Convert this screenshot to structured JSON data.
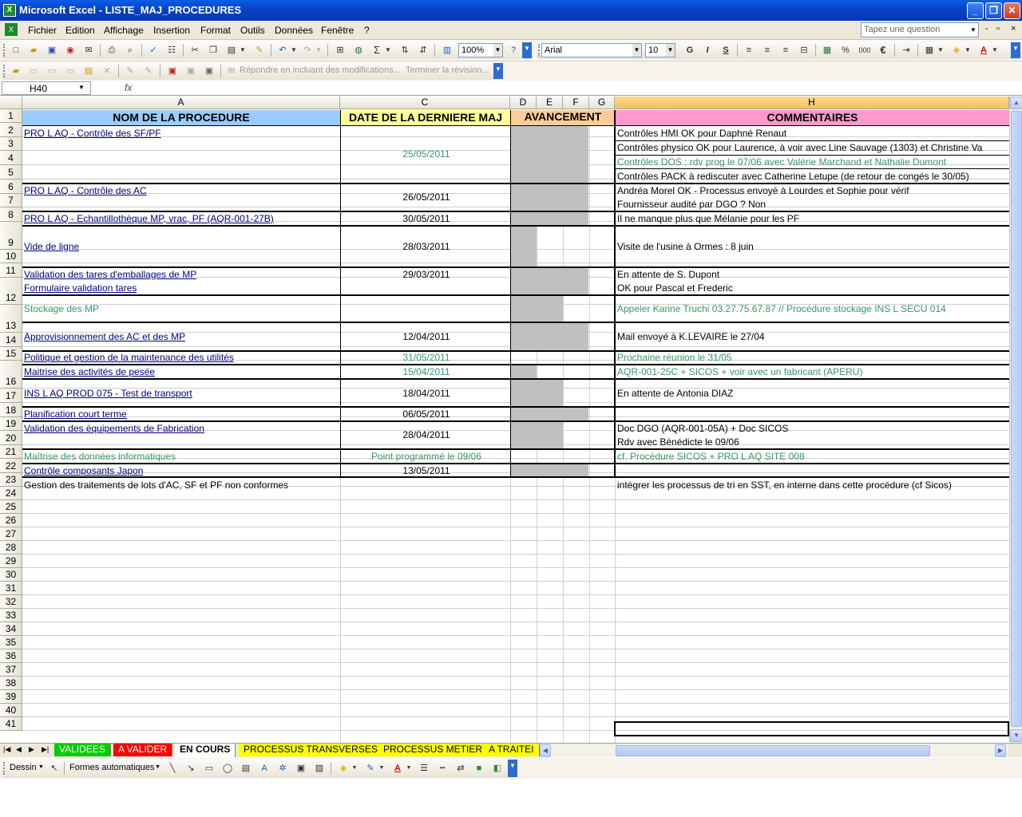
{
  "window": {
    "title": "Microsoft Excel - LISTE_MAJ_PROCEDURES",
    "minimize": "_",
    "maximize": "❐",
    "close": "✕"
  },
  "menu": {
    "items": [
      "Fichier",
      "Edition",
      "Affichage",
      "Insertion",
      "Format",
      "Outils",
      "Données",
      "Fenêtre",
      "?"
    ],
    "ask_placeholder": "Tapez une question",
    "doc_controls": [
      "-",
      "▫",
      "×"
    ]
  },
  "toolbar": {
    "zoom": "100%",
    "font": "Arial",
    "font_size": "10",
    "bold": "G",
    "italic": "I",
    "underline": "S",
    "percent": "%",
    "thousands": "000",
    "euro": "€",
    "sum": "Σ",
    "review_reply": "Répondre en incluant des modifications...",
    "review_end": "Terminer la révision..."
  },
  "formula_bar": {
    "name_box": "H40",
    "fx": "fx",
    "value": ""
  },
  "columns": [
    "A",
    "C",
    "D",
    "E",
    "F",
    "G",
    "H"
  ],
  "header_row": {
    "nom": "NOM DE LA PROCEDURE",
    "date": "DATE DE LA DERNIERE MAJ",
    "avancement": "AVANCEMENT",
    "commentaires": "COMMENTAIRES"
  },
  "colors": {
    "header_nom": "#99ccff",
    "header_date": "#ffff99",
    "header_avancement": "#ffcc99",
    "header_commentaires": "#ff99cc",
    "progress_fill": "#c0c0c0",
    "green_text": "#339966",
    "link_text": "#000080",
    "tab_validees": "#00cc00",
    "tab_a_valider": "#ff0000",
    "tab_other": "#ffff00"
  },
  "rows": {
    "r2": {
      "nom": "PRO L AQ - Contrôle des SF/PF",
      "comment": "Contrôles HMI OK pour Daphné Renaut"
    },
    "r3": {
      "comment": "Contrôles physico OK pour Laurence, à voir avec Line Sauvage (1303) et Christine Va"
    },
    "r4": {
      "comment": "Contrôles DOS : rdv prog le 07/06 avec Valérie Marchand et Nathalie Dumont"
    },
    "r5": {
      "comment": "Contrôles PACK à rediscuter avec Catherine Letupe (de retour de congés le 30/05)"
    },
    "d2_5": "25/05/2011",
    "r6": {
      "nom": "PRO L AQ - Contrôle des AC",
      "comment": "Andréa Morel OK - Processus envoyé à Lourdes et Sophie pour vérif"
    },
    "r7": {
      "comment": "Fournisseur audité par DGO ? Non"
    },
    "d6_7": "26/05/2011",
    "r8": {
      "nom": "PRO L AQ - Echantillothèque MP, vrac, PF (AQR-001-27B)",
      "date": "30/05/2011",
      "comment": "Il ne manque plus que Mélanie pour les PF"
    },
    "r9": {
      "nom": "Vide de ligne",
      "date": "28/03/2011",
      "comment": "Visite de l'usine à Ormes : 8 juin"
    },
    "r10": {
      "nom": "Validation des tares d'emballages de MP",
      "date": "29/03/2011",
      "comment": "En attente de S. Dupont"
    },
    "r11": {
      "nom": "Formulaire validation tares",
      "comment": "OK pour Pascal et Frederic"
    },
    "r12": {
      "nom": "Stockage des MP",
      "comment": "Appeler Karine Truchi 03.27.75.67.87 // Procédure stockage INS L SECU 014"
    },
    "r13": {
      "nom": "Approvisionnement des AC et des MP",
      "date": "12/04/2011",
      "comment": "Mail envoyé à K.LEVAIRE le 27/04"
    },
    "r14": {
      "nom": "Politique et gestion de la maintenance des utilités",
      "date": "31/05/2011",
      "comment": "Prochaine réunion le 31/05"
    },
    "r15": {
      "nom": "Maitrise des activités de pesée",
      "date": "15/04/2011",
      "comment": "AQR-001-25C + SICOS + voir avec un fabricant (APERU)"
    },
    "r16": {
      "nom": "INS L AQ PROD 075 - Test de transport",
      "date": "18/04/2011",
      "comment": "En attente de Antonia DIAZ"
    },
    "r17": {
      "nom": "Planification court terme",
      "date": "06/05/2011"
    },
    "r18": {
      "nom": "Validation des équipements de Fabrication",
      "comment": "Doc DGO (AQR-001-05A) + Doc SICOS"
    },
    "r19": {
      "comment": "Rdv avec Bénédicte le 09/06"
    },
    "d18_19": "28/04/2011",
    "r20": {
      "nom": "Maîtrise des données informatiques",
      "date": "Point programmé le 09/06",
      "comment": "cf. Procédure SICOS + PRO L AQ SITE 008"
    },
    "r21": {
      "nom": "Contrôle composants Japon",
      "date": "13/05/2011"
    },
    "r22": {
      "nom": "Gestion des traitements de lots d'AC, SF et PF non conformes",
      "comment": "intégrer les processus de tri en SST, en interne dans cette procédure (cf Sicos)"
    }
  },
  "row_numbers": [
    "1",
    "2",
    "3",
    "4",
    "5",
    "6",
    "7",
    "8",
    "9",
    "10",
    "11",
    "12",
    "13",
    "14",
    "15",
    "16",
    "17",
    "18",
    "19",
    "20",
    "21",
    "22",
    "23",
    "24",
    "25",
    "26",
    "27",
    "28",
    "29",
    "30",
    "31",
    "32",
    "33",
    "34",
    "35",
    "36",
    "37",
    "38",
    "39",
    "40",
    "41"
  ],
  "sheet_tabs": [
    {
      "label": "VALIDEES",
      "active": false
    },
    {
      "label": "A VALIDER",
      "active": false
    },
    {
      "label": "EN COURS",
      "active": true
    },
    {
      "label": "PROCESSUS TRANSVERSES",
      "active": false
    },
    {
      "label": "PROCESSUS METIER",
      "active": false
    },
    {
      "label": "A TRAITEI",
      "active": false
    }
  ],
  "drawing_bar": {
    "dessin": "Dessin",
    "formes": "Formes automatiques"
  }
}
